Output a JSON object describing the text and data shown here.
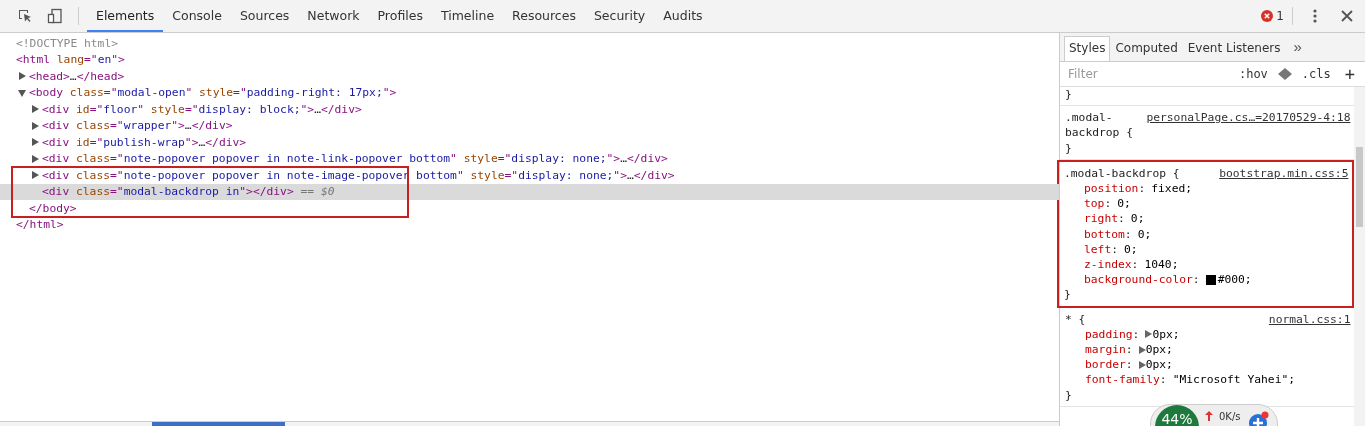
{
  "toolbar": {
    "tabs": [
      {
        "label": "Elements",
        "selected": true
      },
      {
        "label": "Console",
        "selected": false
      },
      {
        "label": "Sources",
        "selected": false
      },
      {
        "label": "Network",
        "selected": false
      },
      {
        "label": "Profiles",
        "selected": false
      },
      {
        "label": "Timeline",
        "selected": false
      },
      {
        "label": "Resources",
        "selected": false
      },
      {
        "label": "Security",
        "selected": false
      },
      {
        "label": "Audits",
        "selected": false
      }
    ],
    "error_count": "1"
  },
  "dom": [
    {
      "selected": false,
      "boxed": false,
      "line": [
        {
          "kind": "comment",
          "text": "<!DOCTYPE html>"
        }
      ]
    },
    {
      "selected": false,
      "boxed": false,
      "line": [
        {
          "kind": "tag",
          "text": "<html "
        },
        {
          "kind": "attr",
          "text": "lang"
        },
        {
          "kind": "tag",
          "text": "=\""
        },
        {
          "kind": "value",
          "text": "en"
        },
        {
          "kind": "tag",
          "text": "\">"
        }
      ],
      "close": [
        {
          "kind": "tag",
          "text": "</html>"
        }
      ],
      "children": [
        {
          "selected": false,
          "boxed": false,
          "expanded": false,
          "line": [
            {
              "kind": "tag",
              "text": "<head>"
            },
            {
              "kind": "text",
              "text": "…"
            },
            {
              "kind": "tag",
              "text": "</head>"
            }
          ]
        },
        {
          "selected": false,
          "boxed": false,
          "expanded": true,
          "close_boxed": true,
          "line": [
            {
              "kind": "tag",
              "text": "<body "
            },
            {
              "kind": "attr",
              "text": "class"
            },
            {
              "kind": "tag",
              "text": "=\""
            },
            {
              "kind": "value",
              "text": "modal-open"
            },
            {
              "kind": "tag",
              "text": "\" "
            },
            {
              "kind": "attr",
              "text": "style"
            },
            {
              "kind": "tag",
              "text": "=\""
            },
            {
              "kind": "value",
              "text": "padding-right: 17px;"
            },
            {
              "kind": "tag",
              "text": "\">"
            }
          ],
          "close": [
            {
              "kind": "tag",
              "text": "</body>"
            }
          ],
          "children": [
            {
              "selected": false,
              "boxed": false,
              "expanded": false,
              "line": [
                {
                  "kind": "tag",
                  "text": "<div "
                },
                {
                  "kind": "attr",
                  "text": "id"
                },
                {
                  "kind": "tag",
                  "text": "=\""
                },
                {
                  "kind": "value",
                  "text": "floor"
                },
                {
                  "kind": "tag",
                  "text": "\" "
                },
                {
                  "kind": "attr",
                  "text": "style"
                },
                {
                  "kind": "tag",
                  "text": "=\""
                },
                {
                  "kind": "value",
                  "text": "display: block;"
                },
                {
                  "kind": "tag",
                  "text": "\">"
                },
                {
                  "kind": "text",
                  "text": "…"
                },
                {
                  "kind": "tag",
                  "text": "</div>"
                }
              ]
            },
            {
              "selected": false,
              "boxed": false,
              "expanded": false,
              "line": [
                {
                  "kind": "tag",
                  "text": "<div "
                },
                {
                  "kind": "attr",
                  "text": "class"
                },
                {
                  "kind": "tag",
                  "text": "=\""
                },
                {
                  "kind": "value",
                  "text": "wrapper"
                },
                {
                  "kind": "tag",
                  "text": "\">"
                },
                {
                  "kind": "text",
                  "text": "…"
                },
                {
                  "kind": "tag",
                  "text": "</div>"
                }
              ]
            },
            {
              "selected": false,
              "boxed": false,
              "expanded": false,
              "line": [
                {
                  "kind": "tag",
                  "text": "<div "
                },
                {
                  "kind": "attr",
                  "text": "id"
                },
                {
                  "kind": "tag",
                  "text": "=\""
                },
                {
                  "kind": "value",
                  "text": "publish-wrap"
                },
                {
                  "kind": "tag",
                  "text": "\">"
                },
                {
                  "kind": "text",
                  "text": "…"
                },
                {
                  "kind": "tag",
                  "text": "</div>"
                }
              ]
            },
            {
              "selected": false,
              "boxed": false,
              "expanded": false,
              "line": [
                {
                  "kind": "tag",
                  "text": "<div "
                },
                {
                  "kind": "attr",
                  "text": "class"
                },
                {
                  "kind": "tag",
                  "text": "=\""
                },
                {
                  "kind": "value",
                  "text": "note-popover popover in note-link-popover bottom"
                },
                {
                  "kind": "tag",
                  "text": "\" "
                },
                {
                  "kind": "attr",
                  "text": "style"
                },
                {
                  "kind": "tag",
                  "text": "=\""
                },
                {
                  "kind": "value",
                  "text": "display: none;"
                },
                {
                  "kind": "tag",
                  "text": "\">"
                },
                {
                  "kind": "text",
                  "text": "…"
                },
                {
                  "kind": "tag",
                  "text": "</div>"
                }
              ]
            },
            {
              "selected": false,
              "boxed": true,
              "expanded": false,
              "line": [
                {
                  "kind": "tag",
                  "text": "<div "
                },
                {
                  "kind": "attr",
                  "text": "class"
                },
                {
                  "kind": "tag",
                  "text": "=\""
                },
                {
                  "kind": "value",
                  "text": "note-popover popover in note-image-popover bottom"
                },
                {
                  "kind": "tag",
                  "text": "\" "
                },
                {
                  "kind": "attr",
                  "text": "style"
                },
                {
                  "kind": "tag",
                  "text": "=\""
                },
                {
                  "kind": "value",
                  "text": "display: none;"
                },
                {
                  "kind": "tag",
                  "text": "\">"
                },
                {
                  "kind": "text",
                  "text": "…"
                },
                {
                  "kind": "tag",
                  "text": "</div>"
                }
              ]
            },
            {
              "selected": true,
              "boxed": true,
              "line": [
                {
                  "kind": "tag",
                  "text": "<div "
                },
                {
                  "kind": "attr",
                  "text": "class"
                },
                {
                  "kind": "tag",
                  "text": "=\""
                },
                {
                  "kind": "value",
                  "text": "modal-backdrop in"
                },
                {
                  "kind": "tag",
                  "text": "\">"
                },
                {
                  "kind": "tag",
                  "text": "</div>"
                },
                {
                  "kind": "marker",
                  "text": " == $0"
                }
              ]
            }
          ]
        }
      ]
    }
  ],
  "styles": {
    "tabs": [
      {
        "label": "Styles",
        "selected": true
      },
      {
        "label": "Computed",
        "selected": false
      },
      {
        "label": "Event Listeners",
        "selected": false
      }
    ],
    "more": "»",
    "filter": {
      "placeholder": "Filter",
      "hov": ":hov",
      "cls": ".cls",
      "add": "+"
    },
    "rules": [
      {
        "boxed": false,
        "close": "}"
      },
      {
        "boxed": false,
        "selector": ".modal-backdrop {",
        "source": "personalPage.cs…=20170529-4:18",
        "close": "}"
      },
      {
        "boxed": true,
        "selector": ".modal-backdrop {",
        "source": "bootstrap.min.css:5",
        "close": "}",
        "declarations": [
          {
            "kind": "plain",
            "name": "position",
            "colon": ":",
            "value": "fixed;"
          },
          {
            "kind": "plain",
            "name": "top",
            "colon": ":",
            "value": "0;"
          },
          {
            "kind": "plain",
            "name": "right",
            "colon": ":",
            "value": "0;"
          },
          {
            "kind": "plain",
            "name": "bottom",
            "colon": ":",
            "value": "0;"
          },
          {
            "kind": "plain",
            "name": "left",
            "colon": ":",
            "value": "0;"
          },
          {
            "kind": "plain",
            "name": "z-index",
            "colon": ":",
            "value": "1040;"
          },
          {
            "kind": "color",
            "name": "background-color",
            "colon": ":",
            "value": "#000;",
            "color": "#000000"
          }
        ]
      },
      {
        "boxed": false,
        "selector": "* {",
        "source": "normal.css:1",
        "close": "}",
        "declarations": [
          {
            "kind": "shorthand",
            "name": "padding",
            "colon": ":",
            "value": "0px;"
          },
          {
            "kind": "shorthand",
            "name": "margin",
            "colon": ":",
            "value": "0px;"
          },
          {
            "kind": "shorthand",
            "name": "border",
            "colon": ":",
            "value": "0px;"
          },
          {
            "kind": "plain",
            "name": "font-family",
            "colon": ":",
            "value": "\"Microsoft Yahei\";"
          }
        ]
      }
    ]
  },
  "net_widget": {
    "percent": "44%",
    "rate": "0K/s"
  }
}
